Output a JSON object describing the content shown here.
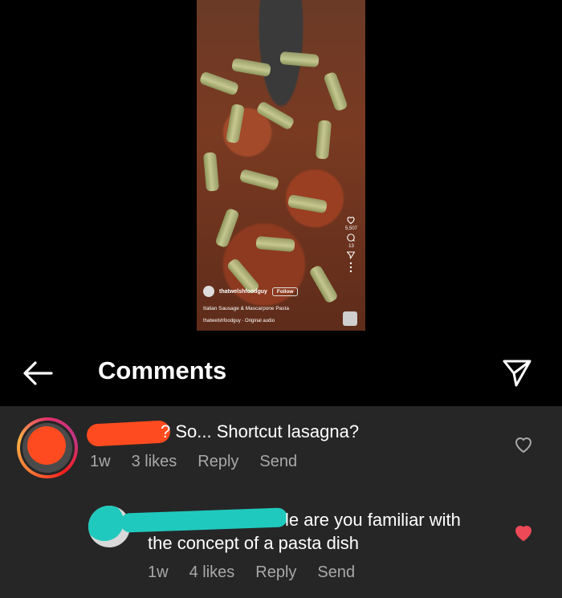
{
  "reel": {
    "likes": "5,507",
    "comments_count": "13",
    "username": "thatwelshfoodguy",
    "follow_label": "Follow",
    "caption": "Italian Sausage & Mascarpone Pasta",
    "audio": "thatwelshfoodguy · Original audio"
  },
  "header": {
    "title": "Comments"
  },
  "comments": [
    {
      "text_visible": "? So... Shortcut lasagna?",
      "time": "1w",
      "likes": "3 likes",
      "reply_label": "Reply",
      "send_label": "Send",
      "liked": false
    },
    {
      "text_line1": "le are you familiar with",
      "text_line2": "the concept of a pasta dish",
      "time": "1w",
      "likes": "4 likes",
      "reply_label": "Reply",
      "send_label": "Send",
      "liked": true
    }
  ],
  "colors": {
    "background": "#000000",
    "comment_panel": "#262626",
    "meta_text": "#a8a8a8",
    "liked_heart": "#ed4956",
    "redaction_orange": "#ff4b1f",
    "redaction_teal": "#20c9bd"
  },
  "icons": [
    "back-arrow-icon",
    "share-icon",
    "heart-icon",
    "heart-filled-icon",
    "comment-icon",
    "send-icon",
    "more-icon"
  ]
}
